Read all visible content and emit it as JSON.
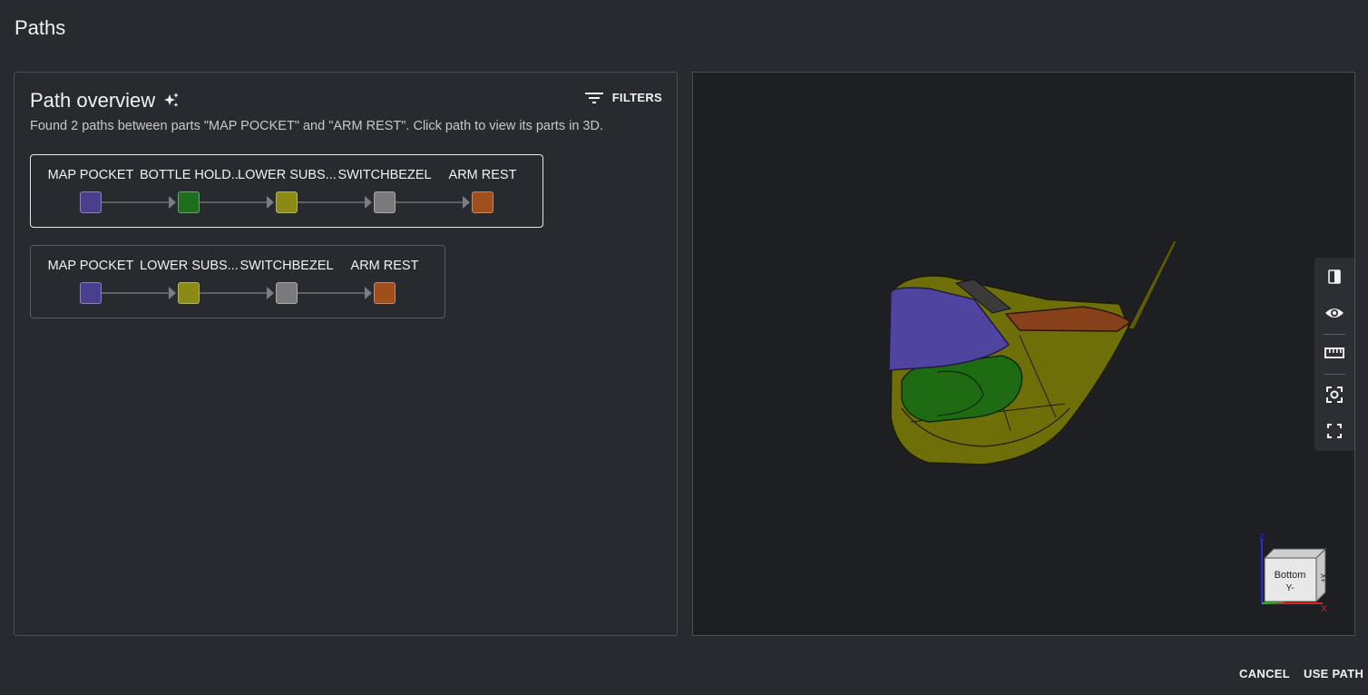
{
  "page": {
    "title": "Paths"
  },
  "overview": {
    "title": "Path overview",
    "filters_label": "FILTERS",
    "subtitle": "Found 2 paths between parts \"MAP POCKET\" and \"ARM REST\". Click path to view its parts in 3D."
  },
  "paths": [
    {
      "selected": true,
      "nodes": [
        {
          "label": "MAP POCKET",
          "color": "#4a3f8f"
        },
        {
          "label": "BOTTLE HOLD...",
          "color": "#1e6e1e"
        },
        {
          "label": "LOWER SUBS...",
          "color": "#8a8a14"
        },
        {
          "label": "SWITCHBEZEL",
          "color": "#7a7a7a"
        },
        {
          "label": "ARM REST",
          "color": "#a04e1c"
        }
      ]
    },
    {
      "selected": false,
      "nodes": [
        {
          "label": "MAP POCKET",
          "color": "#4a3f8f"
        },
        {
          "label": "LOWER SUBS...",
          "color": "#8a8a14"
        },
        {
          "label": "SWITCHBEZEL",
          "color": "#7a7a7a"
        },
        {
          "label": "ARM REST",
          "color": "#a04e1c"
        }
      ]
    }
  ],
  "viewer": {
    "cube_face_front": "Bottom",
    "cube_face_front_sub": "Y-",
    "cube_face_side": "X+",
    "axis_z": "Z",
    "axis_x": "X",
    "toolbar_icons": [
      "section-view-icon",
      "visibility-icon",
      "measure-icon",
      "focus-icon",
      "fullscreen-icon"
    ]
  },
  "footer": {
    "cancel_label": "CANCEL",
    "use_label": "USE PATH"
  }
}
